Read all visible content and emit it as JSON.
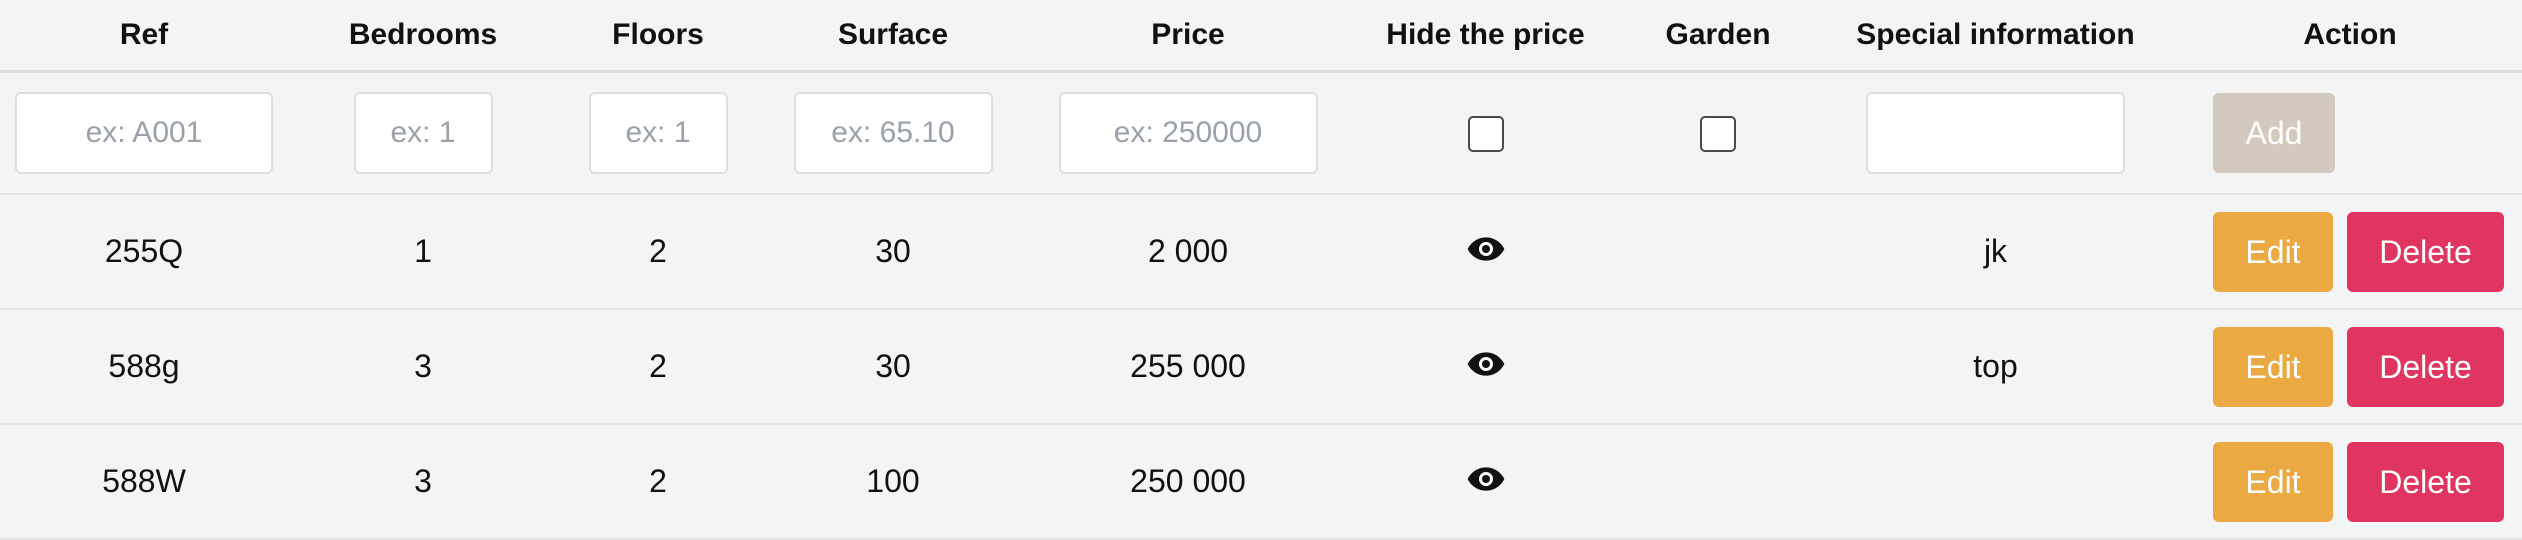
{
  "table": {
    "headers": [
      "Ref",
      "Bedrooms",
      "Floors",
      "Surface",
      "Price",
      "Hide the price",
      "Garden",
      "Special information",
      "Action"
    ],
    "form": {
      "ref_placeholder": "ex: A001",
      "bedrooms_placeholder": "ex: 1",
      "floors_placeholder": "ex: 1",
      "surface_placeholder": "ex: 65.10",
      "price_placeholder": "ex: 250000",
      "special_value": "",
      "hide_price_checked": false,
      "garden_checked": false,
      "add_label": "Add"
    },
    "rows": [
      {
        "ref": "255Q",
        "bedrooms": "1",
        "floors": "2",
        "surface": "30",
        "price": "2 000",
        "hide_price_icon": "eye-icon",
        "garden": "",
        "special": "jk"
      },
      {
        "ref": "588g",
        "bedrooms": "3",
        "floors": "2",
        "surface": "30",
        "price": "255 000",
        "hide_price_icon": "eye-icon",
        "garden": "",
        "special": "top"
      },
      {
        "ref": "588W",
        "bedrooms": "3",
        "floors": "2",
        "surface": "100",
        "price": "250 000",
        "hide_price_icon": "eye-icon",
        "garden": "",
        "special": ""
      }
    ],
    "edit_label": "Edit",
    "delete_label": "Delete"
  },
  "colors": {
    "background": "#f3f4f6",
    "add_button": "#d3c9bf",
    "edit_button": "#eba944",
    "delete_button": "#e13561"
  }
}
